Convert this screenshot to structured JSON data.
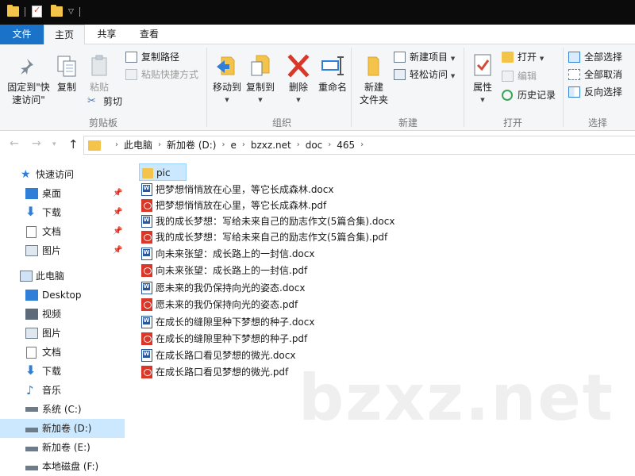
{
  "ribbon_tabs": [
    "文件",
    "主页",
    "共享",
    "查看"
  ],
  "clipboard": {
    "pin_label_1": "固定到\"快",
    "pin_label_2": "速访问\"",
    "copy": "复制",
    "paste": "粘贴",
    "copy_path": "复制路径",
    "paste_shortcut": "粘贴快捷方式",
    "cut": "剪切",
    "group": "剪贴板"
  },
  "organize": {
    "move_to": "移动到",
    "copy_to": "复制到",
    "delete": "删除",
    "rename": "重命名",
    "group": "组织"
  },
  "new": {
    "new_folder_1": "新建",
    "new_folder_2": "文件夹",
    "new_item": "新建项目",
    "easy_access": "轻松访问",
    "group": "新建"
  },
  "open": {
    "properties": "属性",
    "open": "打开",
    "edit": "编辑",
    "history": "历史记录",
    "group": "打开"
  },
  "select": {
    "select_all": "全部选择",
    "select_none": "全部取消",
    "invert": "反向选择",
    "group": "选择"
  },
  "breadcrumb": [
    "此电脑",
    "新加卷 (D:)",
    "e",
    "bzxz.net",
    "doc",
    "465"
  ],
  "sidebar": {
    "quick_access": "快速访问",
    "quick_items": [
      "桌面",
      "下载",
      "文档",
      "图片"
    ],
    "this_pc": "此电脑",
    "pc_items": [
      "Desktop",
      "视频",
      "图片",
      "文档",
      "下载",
      "音乐",
      "系统 (C:)",
      "新加卷 (D:)",
      "新加卷 (E:)",
      "本地磁盘 (F:)"
    ]
  },
  "files": [
    {
      "name": "pic",
      "type": "folder"
    },
    {
      "name": "把梦想悄悄放在心里，等它长成森林.docx",
      "type": "docx"
    },
    {
      "name": "把梦想悄悄放在心里，等它长成森林.pdf",
      "type": "pdf"
    },
    {
      "name": "我的成长梦想：写给未来自己的励志作文(5篇合集).docx",
      "type": "docx"
    },
    {
      "name": "我的成长梦想：写给未来自己的励志作文(5篇合集).pdf",
      "type": "pdf"
    },
    {
      "name": "向未来张望：成长路上的一封信.docx",
      "type": "docx"
    },
    {
      "name": "向未来张望：成长路上的一封信.pdf",
      "type": "pdf"
    },
    {
      "name": "愿未来的我仍保持向光的姿态.docx",
      "type": "docx"
    },
    {
      "name": "愿未来的我仍保持向光的姿态.pdf",
      "type": "pdf"
    },
    {
      "name": "在成长的缝隙里种下梦想的种子.docx",
      "type": "docx"
    },
    {
      "name": "在成长的缝隙里种下梦想的种子.pdf",
      "type": "pdf"
    },
    {
      "name": "在成长路口看见梦想的微光.docx",
      "type": "docx"
    },
    {
      "name": "在成长路口看见梦想的微光.pdf",
      "type": "pdf"
    }
  ],
  "watermark": "bzxz.net",
  "colors": {
    "file_tab": "#1a73c9",
    "selection": "#cce8ff",
    "folder": "#f3c34a",
    "pdf": "#d8372a",
    "docx": "#2b579a"
  }
}
